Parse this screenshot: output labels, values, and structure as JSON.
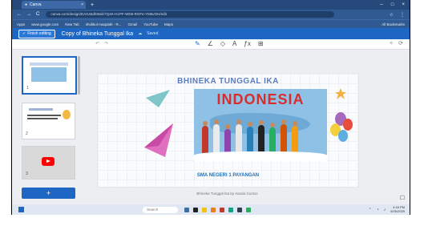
{
  "browser": {
    "tab_title": "Canva",
    "tab_close": "×",
    "new_tab": "+",
    "window_controls": [
      "–",
      "□",
      "×"
    ],
    "nav": [
      "←",
      "→",
      "C"
    ],
    "url": "canva.com/design/DAGs5dh9tak/7Q4K-H1PF-WD6-RGFe-YM6vOH/edit",
    "right_icons": [
      "☆",
      "⋮"
    ],
    "bookmarks": [
      "Apps",
      "www.google.com",
      "New Tab",
      "sholikul-maqolah - R...",
      "Gmail",
      "YouTube",
      "Maps"
    ],
    "all_bookmarks": "All Bookmarks"
  },
  "app": {
    "finish_label": "Finish editing",
    "doc_title": "Copy of Bhineka Tunggal Ika",
    "saved_label": "Saved",
    "tool_icons": [
      "pen-icon",
      "highlighter-icon",
      "eraser-icon",
      "text-icon",
      "fx-icon",
      "grid-icon"
    ],
    "tool_glyphs": [
      "✎",
      "∠",
      "◇",
      "A",
      "ƒx",
      "⊞"
    ]
  },
  "sidebar": {
    "pages": [
      "1",
      "2",
      "3"
    ],
    "add_label": "+"
  },
  "slide": {
    "heading": "BHINEKA TUNGGAL IKA",
    "banner": "INDONESIA",
    "school": "SMA NEGERI 1 PAYANGAN",
    "caption": "Bhineka Tunggal Ika by Aanda Gustos"
  },
  "taskbar": {
    "search_placeholder": "Search",
    "time": "4:16 PM",
    "date": "5/26/2025"
  },
  "colors": {
    "accent": "#1d66c3",
    "browser": "#2f5a92",
    "banner_red": "#d82d2d"
  }
}
